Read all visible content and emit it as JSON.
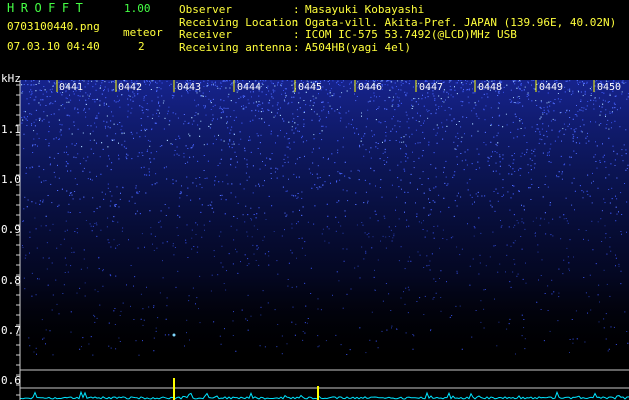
{
  "header": {
    "app_title": "HROFFT",
    "app_version": "1.00",
    "image_file": "0703100440.png",
    "timestamp": "07.03.10 04:40",
    "meteor_label": "meteor",
    "meteor_count": "2"
  },
  "info": {
    "separator": ":",
    "rows": [
      {
        "label": "Observer",
        "value": "Masayuki Kobayashi"
      },
      {
        "label": "Receiving Location",
        "value": "Ogata-vill. Akita-Pref. JAPAN (139.96E, 40.02N)"
      },
      {
        "label": "Receiver",
        "value": "ICOM IC-575 53.7492(@LCD)MHz USB"
      },
      {
        "label": "Receiving antenna",
        "value": "A504HB(yagi 4el)"
      }
    ]
  },
  "spectrogram": {
    "y_unit": "kHz",
    "y_ticks": [
      "1.1",
      "1.0",
      "0.9",
      "0.8",
      "0.7",
      "0.6"
    ],
    "time_labels": [
      "0441",
      "0442",
      "0443",
      "0444",
      "0445",
      "0446",
      "0447",
      "0448",
      "0449",
      "0450"
    ],
    "colors": {
      "label": "#ffffff",
      "text": "#ffff3c",
      "title": "#45ff45",
      "noise": "#2a3cff",
      "echo": "#ffff00",
      "trace": "#00e5ff"
    }
  }
}
